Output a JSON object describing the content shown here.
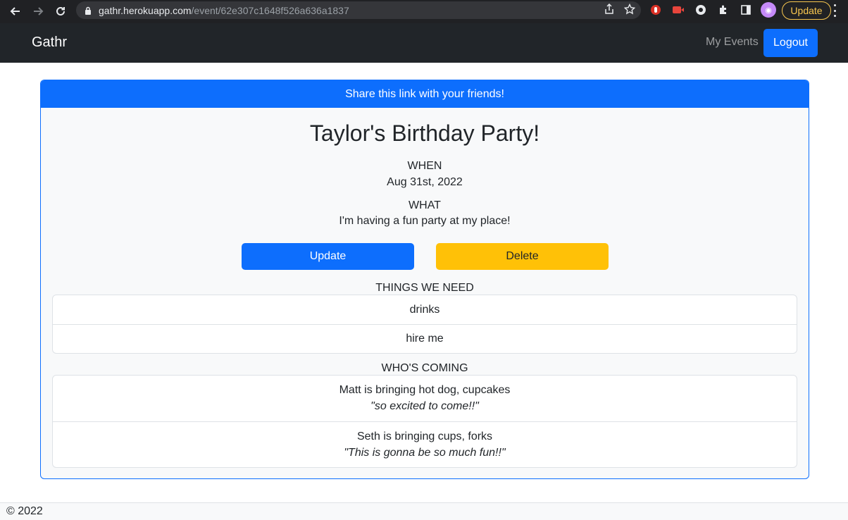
{
  "browser": {
    "url_host": "gathr.herokuapp.com",
    "url_path": "/event/62e307c1648f526a636a1837",
    "update_label": "Update",
    "icons": [
      "back-icon",
      "forward-icon",
      "reload-icon",
      "lock-icon",
      "share-icon",
      "star-icon",
      "extension-icon",
      "puzzle-icon",
      "sidebar-icon",
      "kebab-icon"
    ]
  },
  "navbar": {
    "brand": "Gathr",
    "my_events": "My Events",
    "logout": "Logout"
  },
  "event": {
    "share_text": "Share this link with your friends!",
    "title": "Taylor's Birthday Party!",
    "when_label": "WHEN",
    "when_value": "Aug 31st, 2022",
    "what_label": "WHAT",
    "what_value": "I'm having a fun party at my place!",
    "update_label": "Update",
    "delete_label": "Delete",
    "needs_label": "THINGS WE NEED",
    "needs": [
      "drinks",
      "hire me"
    ],
    "coming_label": "WHO'S COMING",
    "guests": [
      {
        "text": "Matt is bringing hot dog, cupcakes",
        "comment": "\"so excited to come!!\""
      },
      {
        "text": "Seth is bringing cups, forks",
        "comment": "\"This is gonna be so much fun!!\""
      }
    ]
  },
  "footer": {
    "copyright": "© 2022"
  },
  "colors": {
    "primary": "#0d6efd",
    "warning": "#ffc107",
    "navbar": "#212529",
    "chrome": "#202124"
  }
}
